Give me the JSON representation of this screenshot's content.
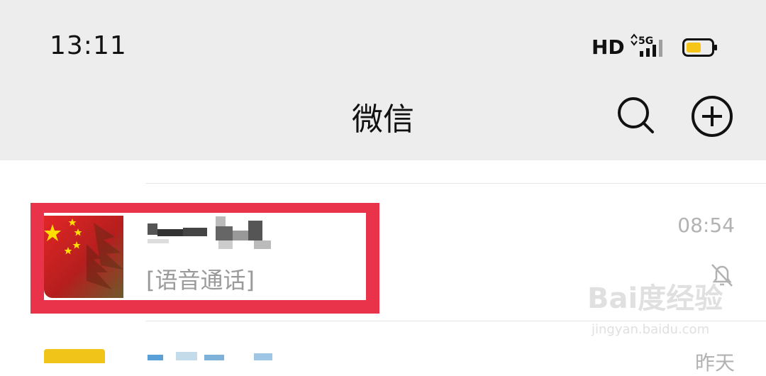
{
  "status_bar": {
    "time": "13:11",
    "hd_label": "HD",
    "network_label": "5G",
    "battery_color": "#f5c518"
  },
  "header": {
    "title": "微信",
    "search_icon": "search-icon",
    "add_icon": "plus-circle-icon"
  },
  "chats": [
    {
      "preview": "[语音通话]",
      "time": "08:54",
      "muted": true
    }
  ],
  "next_chat": {
    "time": "昨天"
  },
  "watermark": {
    "main": "Bai度经验",
    "sub": "jingyan.baidu.com"
  },
  "colors": {
    "header_bg": "#ededed",
    "highlight_border": "#e8334a",
    "preview_text": "#9a9a9a",
    "time_text": "#b2b2b2"
  }
}
